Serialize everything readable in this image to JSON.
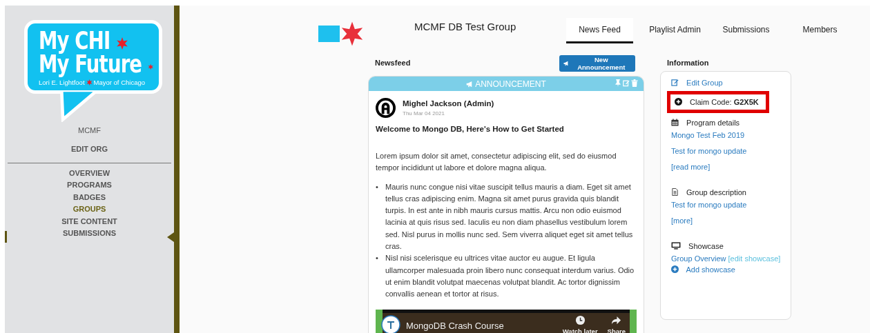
{
  "logo": {
    "line_1": "My CHI",
    "line_2": "My Future",
    "tagline_left": "Lori E. Lightfoot",
    "tagline_right": "Mayor of Chicago"
  },
  "sidebar": {
    "org": "MCMF",
    "edit": "EDIT ORG",
    "items": [
      {
        "label": "OVERVIEW",
        "selected": false
      },
      {
        "label": "PROGRAMS",
        "selected": false
      },
      {
        "label": "BADGES",
        "selected": false
      },
      {
        "label": "GROUPS",
        "selected": true
      },
      {
        "label": "SITE CONTENT",
        "selected": false
      },
      {
        "label": "SUBMISSIONS",
        "selected": false
      }
    ]
  },
  "header": {
    "title": "MCMF DB Test Group",
    "tabs": [
      {
        "label": "News Feed",
        "selected": true
      },
      {
        "label": "Playlist Admin",
        "selected": false
      },
      {
        "label": "Submissions",
        "selected": false
      },
      {
        "label": "Members",
        "selected": false
      }
    ]
  },
  "newsfeed": {
    "title": "Newsfeed",
    "button": "New Announcement",
    "post": {
      "banner": "ANNOUNCEMENT",
      "author": "Mighel Jackson (Admin)",
      "date": "Thu Mar 04 2021",
      "headline": "Welcome to Mongo DB, Here's How to Get Started",
      "paragraph": "Lorem ipsum dolor sit amet, consectetur adipiscing elit, sed do eiusmod tempor incididunt ut labore et dolore magna aliqua.",
      "bullets": [
        {
          "marker": "•",
          "text": "Mauris nunc congue nisi vitae suscipit tellus mauris a diam. Eget sit amet tellus cras adipiscing enim. Magna sit amet purus gravida quis blandit turpis. In est ante in nibh mauris cursus mattis. Arcu non odio euismod lacinia at quis risus sed. Iaculis eu non diam phasellus vestibulum lorem sed. Nisl purus in mollis nunc sed. Sem viverra aliquet eget sit amet tellus cras."
        },
        {
          "marker": "•",
          "text": "Nisl nisi scelerisque eu ultrices vitae auctor eu augue. Et ligula ullamcorper malesuada proin libero nunc consequat interdum varius. Odio ut enim blandit volutpat maecenas volutpat blandit. Ac tortor dignissim convallis aenean et tortor at risus."
        }
      ],
      "video": {
        "title": "MongoDB Crash Course",
        "watch_later": "Watch later",
        "share": "Share"
      }
    }
  },
  "information": {
    "title": "Information",
    "items": [
      {
        "kind": "edit",
        "label": "Edit Group"
      },
      {
        "kind": "claim",
        "label": "Claim Code:",
        "code": "G2X5K",
        "highlighted": true
      },
      {
        "kind": "program",
        "heading": "Program details",
        "lines": [
          [
            {
              "text": "Mongo Test Feb 2019",
              "muted": false
            }
          ],
          [
            {
              "text": "Test for mongo update",
              "muted": false
            }
          ],
          [
            {
              "text": "[read more]",
              "muted": false
            }
          ]
        ]
      },
      {
        "kind": "description",
        "heading": "Group description",
        "lines": [
          [
            {
              "text": "Test for mongo update",
              "muted": false
            }
          ],
          [
            {
              "text": "[more]",
              "muted": false
            }
          ]
        ]
      },
      {
        "kind": "showcase",
        "heading": "Showcase",
        "lines": [
          [
            {
              "text": "Group Overview",
              "muted": false
            },
            {
              "text": "[edit showcase]",
              "muted": true
            }
          ]
        ]
      },
      {
        "kind": "add",
        "label": "Add showcase"
      }
    ]
  }
}
